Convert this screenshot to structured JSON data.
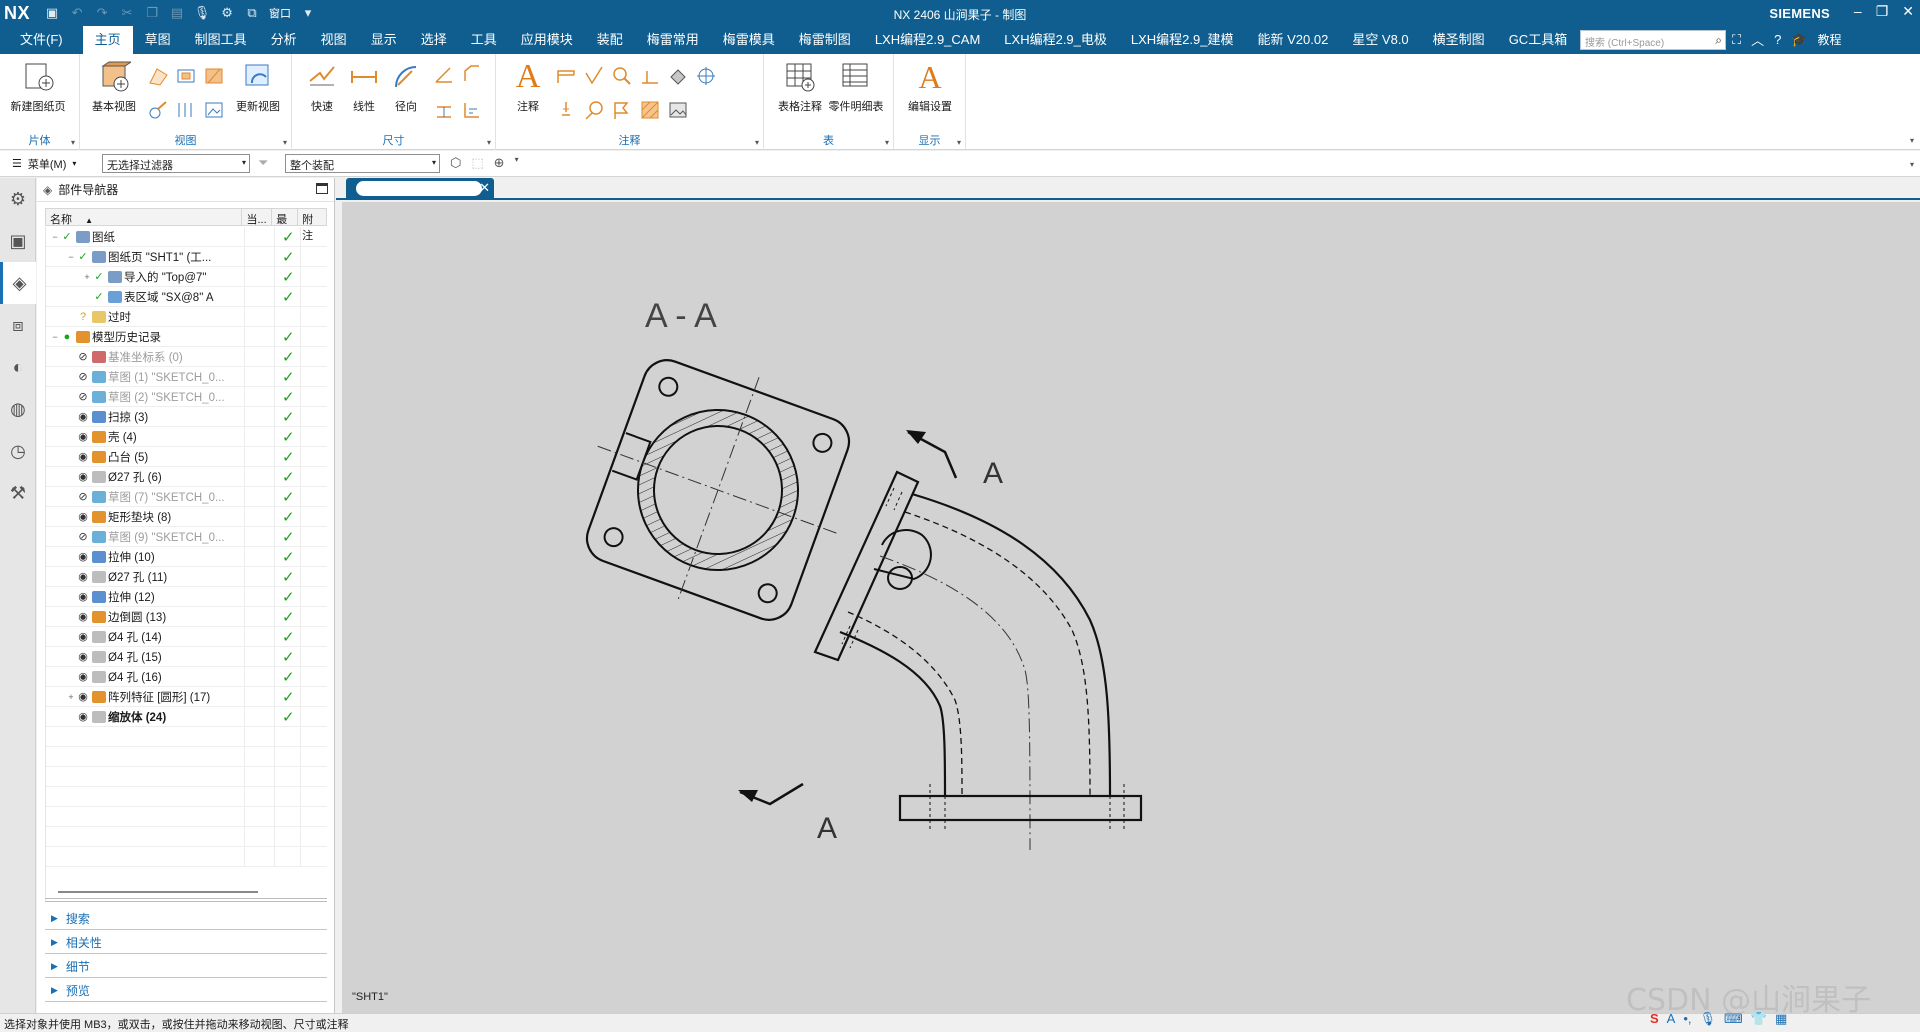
{
  "app": {
    "logo": "NX",
    "title": "NX 2406 山涧果子 - 制图",
    "brand": "SIEMENS",
    "window_menu": "窗口"
  },
  "menubar": {
    "items": [
      "文件(F)",
      "主页",
      "草图",
      "制图工具",
      "分析",
      "视图",
      "显示",
      "选择",
      "工具",
      "应用模块",
      "装配",
      "梅雷常用",
      "梅雷模具",
      "梅雷制图",
      "LXH编程2.9_CAM",
      "LXH编程2.9_电极",
      "LXH编程2.9_建模",
      "能新 V20.02",
      "星空 V8.0",
      "横圣制图",
      "GC工具箱"
    ],
    "active_index": 1,
    "search_placeholder": "搜索 (Ctrl+Space)",
    "tutorial": "教程"
  },
  "ribbon": {
    "groups": [
      {
        "label": "片体"
      },
      {
        "label": "视图"
      },
      {
        "label": "尺寸"
      },
      {
        "label": "注释"
      },
      {
        "label": "表"
      },
      {
        "label": "显示"
      }
    ],
    "buttons": {
      "new_sheet": "新建图纸页",
      "base_view": "基本视图",
      "update_view": "更新视图",
      "rapid": "快速",
      "linear": "线性",
      "radial": "径向",
      "note": "注释",
      "tabular_note": "表格注释",
      "parts_list": "零件明细表",
      "edit_settings": "编辑设置"
    }
  },
  "selbar": {
    "menu": "菜单(M)",
    "filter": "无选择过滤器",
    "scope": "整个装配"
  },
  "navigator": {
    "title": "部件导航器",
    "columns": [
      "名称",
      "当...",
      "最",
      "附注"
    ],
    "rows": [
      {
        "indent": 0,
        "exp": "−",
        "label": "图纸",
        "check": true,
        "style": "normal",
        "icon": "#7a9cc6"
      },
      {
        "indent": 1,
        "exp": "−",
        "label": "图纸页 \"SHT1\" (工...",
        "check": true,
        "style": "normal",
        "icon": "#7a9cc6"
      },
      {
        "indent": 2,
        "exp": "+",
        "label": "导入的 \"Top@7\"",
        "check": true,
        "style": "normal",
        "icon": "#7a9cc6"
      },
      {
        "indent": 2,
        "exp": "",
        "label": "表区域 \"SX@8\" A",
        "check": true,
        "style": "normal",
        "icon": "#6aa0d8"
      },
      {
        "indent": 1,
        "exp": "",
        "label": "过时",
        "check": false,
        "style": "normal",
        "icon": "#e8c766"
      },
      {
        "indent": 0,
        "exp": "−",
        "label": "模型历史记录",
        "check": true,
        "style": "normal",
        "icon": "#e2932e"
      },
      {
        "indent": 1,
        "exp": "",
        "label": "基准坐标系 (0)",
        "check": true,
        "style": "dim",
        "icon": "#d06a6a"
      },
      {
        "indent": 1,
        "exp": "",
        "label": "草图 (1) \"SKETCH_0...",
        "check": true,
        "style": "dim",
        "icon": "#6ab0d8"
      },
      {
        "indent": 1,
        "exp": "",
        "label": "草图 (2) \"SKETCH_0...",
        "check": true,
        "style": "dim",
        "icon": "#6ab0d8"
      },
      {
        "indent": 1,
        "exp": "",
        "label": "扫掠 (3)",
        "check": true,
        "style": "normal",
        "icon": "#5a8fd0"
      },
      {
        "indent": 1,
        "exp": "",
        "label": "壳 (4)",
        "check": true,
        "style": "normal",
        "icon": "#e2932e"
      },
      {
        "indent": 1,
        "exp": "",
        "label": "凸台 (5)",
        "check": true,
        "style": "normal",
        "icon": "#e2932e"
      },
      {
        "indent": 1,
        "exp": "",
        "label": "Ø27 孔 (6)",
        "check": true,
        "style": "normal",
        "icon": "#bdbdbd"
      },
      {
        "indent": 1,
        "exp": "",
        "label": "草图 (7) \"SKETCH_0...",
        "check": true,
        "style": "dim",
        "icon": "#6ab0d8"
      },
      {
        "indent": 1,
        "exp": "",
        "label": "矩形垫块 (8)",
        "check": true,
        "style": "normal",
        "icon": "#e2932e"
      },
      {
        "indent": 1,
        "exp": "",
        "label": "草图 (9) \"SKETCH_0...",
        "check": true,
        "style": "dim",
        "icon": "#6ab0d8"
      },
      {
        "indent": 1,
        "exp": "",
        "label": "拉伸 (10)",
        "check": true,
        "style": "normal",
        "icon": "#5a8fd0"
      },
      {
        "indent": 1,
        "exp": "",
        "label": "Ø27 孔 (11)",
        "check": true,
        "style": "normal",
        "icon": "#bdbdbd"
      },
      {
        "indent": 1,
        "exp": "",
        "label": "拉伸 (12)",
        "check": true,
        "style": "normal",
        "icon": "#5a8fd0"
      },
      {
        "indent": 1,
        "exp": "",
        "label": "边倒圆 (13)",
        "check": true,
        "style": "normal",
        "icon": "#e2932e"
      },
      {
        "indent": 1,
        "exp": "",
        "label": "Ø4 孔 (14)",
        "check": true,
        "style": "normal",
        "icon": "#bdbdbd"
      },
      {
        "indent": 1,
        "exp": "",
        "label": "Ø4 孔 (15)",
        "check": true,
        "style": "normal",
        "icon": "#bdbdbd"
      },
      {
        "indent": 1,
        "exp": "",
        "label": "Ø4 孔 (16)",
        "check": true,
        "style": "normal",
        "icon": "#bdbdbd"
      },
      {
        "indent": 1,
        "exp": "+",
        "label": "阵列特征 [圆形] (17)",
        "check": true,
        "style": "normal",
        "icon": "#e2932e"
      },
      {
        "indent": 1,
        "exp": "",
        "label": "缩放体 (24)",
        "check": true,
        "style": "bold",
        "icon": "#bdbdbd"
      }
    ],
    "sections": [
      "搜索",
      "相关性",
      "细节",
      "预览"
    ]
  },
  "drawing": {
    "section_title": "A - A",
    "arrow_label_top": "A",
    "arrow_label_bottom": "A",
    "sheet_label": "\"SHT1\""
  },
  "status": {
    "message": "选择对象并使用 MB3，或双击，或按住并拖动来移动视图、尺寸或注释",
    "watermark": "CSDN @山涧果子"
  }
}
